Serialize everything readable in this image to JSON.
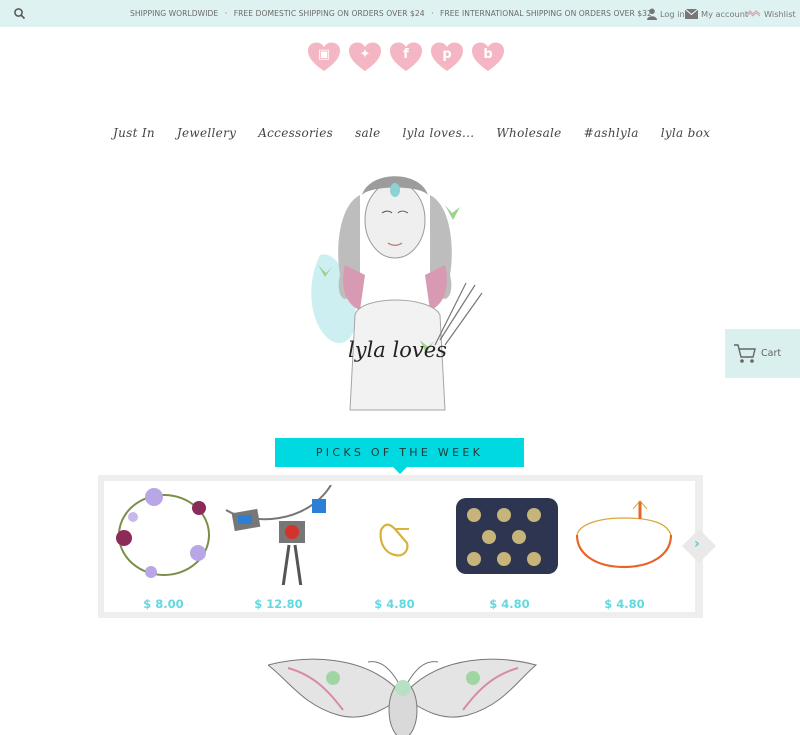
{
  "topbar": {
    "search_icon": "search-icon",
    "shipping": [
      "SHIPPING WORLDWIDE",
      "·",
      "FREE DOMESTIC SHIPPING ON ORDERS OVER $24",
      "·",
      "FREE INTERNATIONAL SHIPPING ON ORDERS OVER $32"
    ],
    "login": "Log in",
    "account": "My account",
    "wishlist": "Wishlist"
  },
  "social": [
    {
      "name": "instagram",
      "glyph": "▣"
    },
    {
      "name": "twitter",
      "glyph": "✦"
    },
    {
      "name": "facebook",
      "glyph": "f"
    },
    {
      "name": "pinterest",
      "glyph": "p"
    },
    {
      "name": "blog",
      "glyph": "b"
    }
  ],
  "nav": [
    "Just In",
    "Jewellery",
    "Accessories",
    "sale",
    "lyla loves...",
    "Wholesale",
    "#ashlyla",
    "lyla box"
  ],
  "hero": {
    "logo_text": "lyla loves"
  },
  "cart": {
    "label": "Cart"
  },
  "picks": {
    "title": "PICKS OF THE WEEK",
    "products": [
      {
        "name": "flower-crown",
        "price": "$ 8.00"
      },
      {
        "name": "statement-necklace",
        "price": "$ 12.80"
      },
      {
        "name": "gold-ring",
        "price": "$ 4.80"
      },
      {
        "name": "patterned-pouch",
        "price": "$ 4.80"
      },
      {
        "name": "orange-bracelet",
        "price": "$ 4.80"
      }
    ],
    "next": "›"
  },
  "colors": {
    "accent": "#00d9df",
    "topbar": "#dff2f2",
    "price": "#63d8de",
    "heart": "#f4b6c2"
  }
}
